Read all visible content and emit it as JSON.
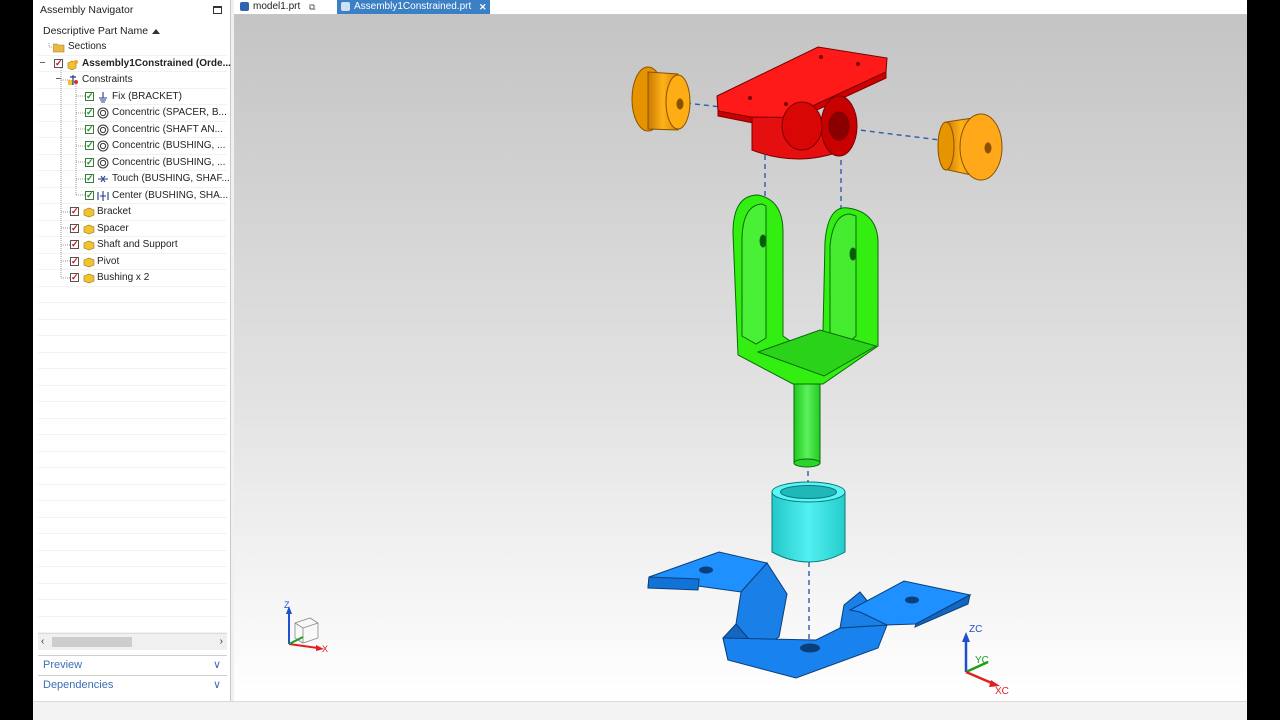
{
  "navigator": {
    "title": "Assembly Navigator",
    "column_header": "Descriptive Part Name",
    "rows": [
      {
        "label": "Sections"
      },
      {
        "label": "Assembly1Constrained (Orde..."
      },
      {
        "label": "Constraints"
      },
      {
        "label": "Fix (BRACKET)"
      },
      {
        "label": "Concentric (SPACER, B..."
      },
      {
        "label": "Concentric (SHAFT AN..."
      },
      {
        "label": "Concentric (BUSHING, ..."
      },
      {
        "label": "Concentric (BUSHING, ..."
      },
      {
        "label": "Touch (BUSHING, SHAF..."
      },
      {
        "label": "Center (BUSHING, SHA..."
      },
      {
        "label": "Bracket"
      },
      {
        "label": "Spacer"
      },
      {
        "label": "Shaft and Support"
      },
      {
        "label": "Pivot"
      },
      {
        "label": "Bushing x 2"
      }
    ],
    "sections": {
      "preview": "Preview",
      "dependencies": "Dependencies"
    }
  },
  "tabs": [
    {
      "label": "model1.prt",
      "active": false
    },
    {
      "label": "Assembly1Constrained.prt",
      "active": true
    }
  ],
  "triad_small": {
    "z": "Z",
    "x": "X"
  },
  "triad_csys": {
    "zc": "ZC",
    "yc": "YC",
    "xc": "XC"
  },
  "colors": {
    "pivot": "#ff1a1a",
    "bushing": "#ffa500",
    "shaft_support": "#33ee11",
    "spacer": "#33e3e3",
    "bracket": "#1e90ff",
    "constraint_line": "#2a5fa8",
    "tab_active": "#3b7fc4"
  }
}
